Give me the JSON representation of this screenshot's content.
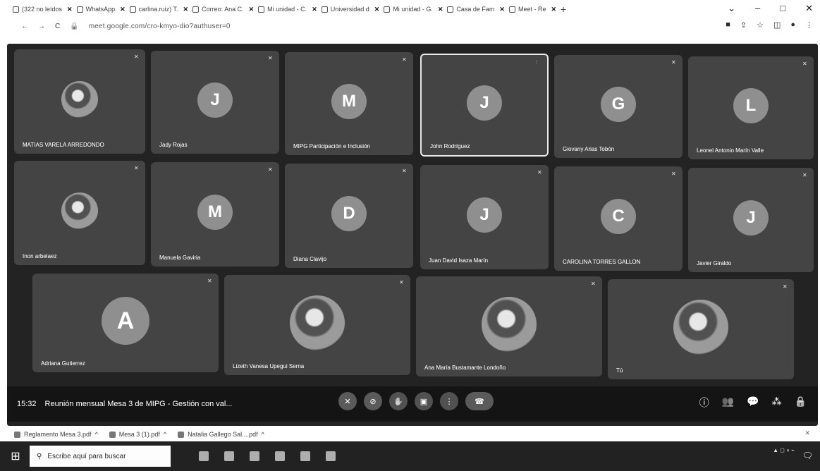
{
  "browser": {
    "tabs": [
      {
        "label": "(322 no leídos"
      },
      {
        "label": "WhatsApp"
      },
      {
        "label": "carlina.ruiz) T."
      },
      {
        "label": "Correo: Ana C."
      },
      {
        "label": "Mi unidad - C."
      },
      {
        "label": "Universidad d"
      },
      {
        "label": "Mi unidad - G."
      },
      {
        "label": "Casa de Fam"
      },
      {
        "label": "Meet - Re"
      }
    ],
    "new_tab": "+",
    "url": "meet.google.com/cro-kmyo-dio?authuser=0",
    "window_controls": [
      "⌄",
      "–",
      "□",
      "✕"
    ]
  },
  "meeting": {
    "time": "15:32",
    "title": "Reunión mensual Mesa 3 de MIPG - Gestión con val...",
    "participants_row1": [
      {
        "name": "MATIAS VARELA ARREDONDO",
        "initial": "",
        "photo": true
      },
      {
        "name": "Jady Rojas",
        "initial": "J",
        "photo": false
      },
      {
        "name": "MIPG Participación e Inclusión",
        "initial": "M",
        "photo": false
      },
      {
        "name": "John Rodríguez",
        "initial": "J",
        "photo": false,
        "active": true
      },
      {
        "name": "Giovany Arias Tobón",
        "initial": "G",
        "photo": false
      },
      {
        "name": "Leonel Antonio Marín Valle",
        "initial": "L",
        "photo": false
      }
    ],
    "participants_row2": [
      {
        "name": "Inon arbelaez",
        "initial": "",
        "photo": true
      },
      {
        "name": "Manuela Gaviria",
        "initial": "M",
        "photo": false
      },
      {
        "name": "Diana Clavijo",
        "initial": "D",
        "photo": false
      },
      {
        "name": "Juan David Isaza Marín",
        "initial": "J",
        "photo": false
      },
      {
        "name": "CAROLINA TORRES GALLON",
        "initial": "C",
        "photo": false
      },
      {
        "name": "Javier Giraldo",
        "initial": "J",
        "photo": false
      }
    ],
    "participants_row3": [
      {
        "name": "Adriana Gutierrez",
        "initial": "A",
        "photo": false
      },
      {
        "name": "Lizeth Vanesa Upegui Serna",
        "initial": "",
        "photo": true
      },
      {
        "name": "Ana María Bustamante Londoño",
        "initial": "",
        "photo": true
      },
      {
        "name": "Tú",
        "initial": "",
        "photo": true
      }
    ]
  },
  "downloads": [
    {
      "label": "Reglamento Mesa 3.pdf"
    },
    {
      "label": "Mesa 3 (1).pdf"
    },
    {
      "label": "Natalia Gallego Sal....pdf"
    }
  ],
  "taskbar": {
    "search_placeholder": "Escribe aquí para buscar"
  }
}
